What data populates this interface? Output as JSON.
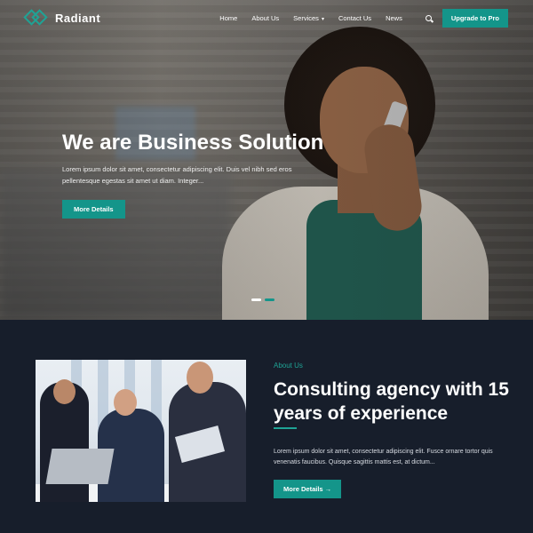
{
  "nav": {
    "logo": "Radiant",
    "menu": [
      "Home",
      "About Us",
      "Services",
      "Contact Us",
      "News"
    ],
    "upgrade": "Upgrade to Pro"
  },
  "hero": {
    "title": "We are Business Solution",
    "text": "Lorem ipsum dolor sit amet, consectetur adipiscing elit. Duis vel nibh sed eros pellentesque egestas sit amet ut diam. Integer...",
    "button": "More Details"
  },
  "about": {
    "tag": "About Us",
    "title": "Consulting agency with 15 years of experience",
    "text": "Lorem ipsum dolor sit amet, consectetur adipiscing elit. Fusce ornare tortor quis venenatis faucibus. Quisque sagittis mattis est, at dictum...",
    "button": "More Details →"
  },
  "colors": {
    "accent": "#14958a",
    "dark": "#171e2b"
  }
}
